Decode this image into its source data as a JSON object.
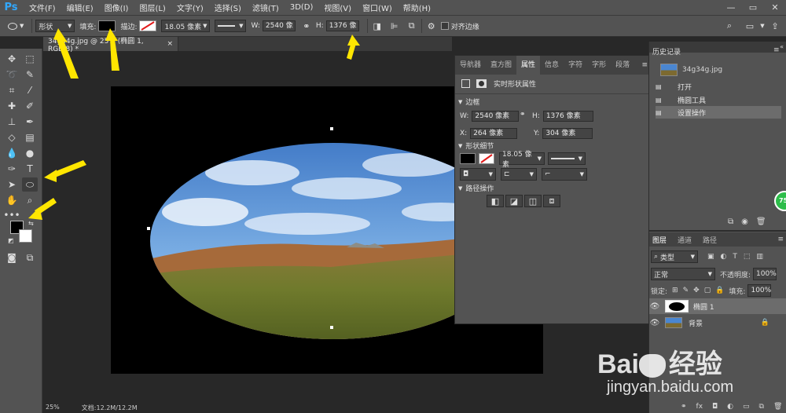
{
  "app": {
    "logo": "Ps"
  },
  "menu": [
    "文件(F)",
    "编辑(E)",
    "图像(I)",
    "图层(L)",
    "文字(Y)",
    "选择(S)",
    "滤镜(T)",
    "3D(D)",
    "视图(V)",
    "窗口(W)",
    "帮助(H)"
  ],
  "window_controls": [
    "—",
    "▭",
    "✕"
  ],
  "options": {
    "mode": "形状",
    "fill_label": "填充:",
    "stroke_label": "描边:",
    "stroke_width": "18.05 像素",
    "w_label": "W:",
    "w_value": "2540 像",
    "h_label": "H:",
    "h_value": "1376 像",
    "align_edges": "对齐边缘"
  },
  "doc_tab": {
    "title": "34g34g.jpg @ 25% (椭圆 1, RGB/8) *",
    "close": "×"
  },
  "status": {
    "zoom": "25%",
    "doc": "文档:12.2M/12.2M"
  },
  "properties": {
    "tabs": [
      "导航器",
      "直方图",
      "属性",
      "信息",
      "字符",
      "字形",
      "段落"
    ],
    "active_tab": "属性",
    "header": "实时形状属性",
    "section_frame": "边框",
    "w_label": "W:",
    "w_value": "2540 像素",
    "h_label": "H:",
    "h_value": "1376 像素",
    "x_label": "X:",
    "x_value": "264 像素",
    "y_label": "Y:",
    "y_value": "304 像素",
    "section_shape": "形状细节",
    "stroke_width": "18.05 像素",
    "section_path": "路径操作"
  },
  "history": {
    "tab": "历史记录",
    "snapshot": "34g34g.jpg",
    "items": [
      "打开",
      "椭圆工具",
      "设置操作"
    ]
  },
  "layers": {
    "tabs": [
      "图层",
      "通道",
      "路径"
    ],
    "filter_kind": "类型",
    "blend_mode": "正常",
    "opacity_label": "不透明度:",
    "opacity_value": "100%",
    "lock_label": "锁定:",
    "fill_label": "填充:",
    "fill_value": "100%",
    "rows": [
      {
        "name": "椭圆 1"
      },
      {
        "name": "背景"
      }
    ]
  },
  "badge": "75",
  "watermark": {
    "brand_left": "Bai",
    "brand_right": "经验",
    "url": "jingyan.baidu.com"
  },
  "colors": {
    "accent": "#31a8ff",
    "panel": "#535353",
    "canvas_bg": "#282828",
    "arrow": "#ffe600"
  }
}
